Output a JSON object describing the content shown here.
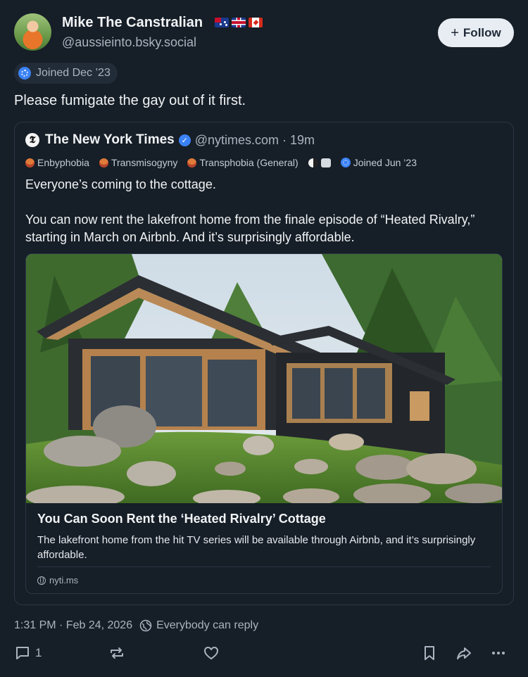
{
  "author": {
    "display_name": "Mike The Canstralian",
    "flags": [
      "flag-australia-icon",
      "flag-uk-icon",
      "flag-canada-icon"
    ],
    "handle": "@aussieinto.bsky.social",
    "joined": "Joined Dec ’23",
    "follow_label": "Follow"
  },
  "post": {
    "text": "Please fumigate the gay out of it first.",
    "timestamp": "1:31 PM · Feb 24, 2026",
    "reply_setting": "Everybody can reply",
    "reply_count": "1"
  },
  "quote": {
    "display_name": "The New York Times",
    "handle": "@nytimes.com · 19m",
    "labels": [
      "Enbyphobia",
      "Transmisogyny",
      "Transphobia (General)"
    ],
    "joined": "Joined Jun ’23",
    "text": "Everyone’s coming to the cottage.\n\nYou can now rent the lakefront home from the finale episode of “Heated Rivalry,” starting in March on Airbnb. And it’s surprisingly affordable.",
    "card": {
      "title": "You Can Soon Rent the ‘Heated Rivalry’ Cottage",
      "description": "The lakefront home from the hit TV series will be available through Airbnb, and it’s surprisingly affordable.",
      "domain": "nyti.ms"
    }
  },
  "colors": {
    "background": "#161e27",
    "accent_blue": "#3b82f6",
    "muted_text": "#aab4c0",
    "border": "#2b3746"
  }
}
